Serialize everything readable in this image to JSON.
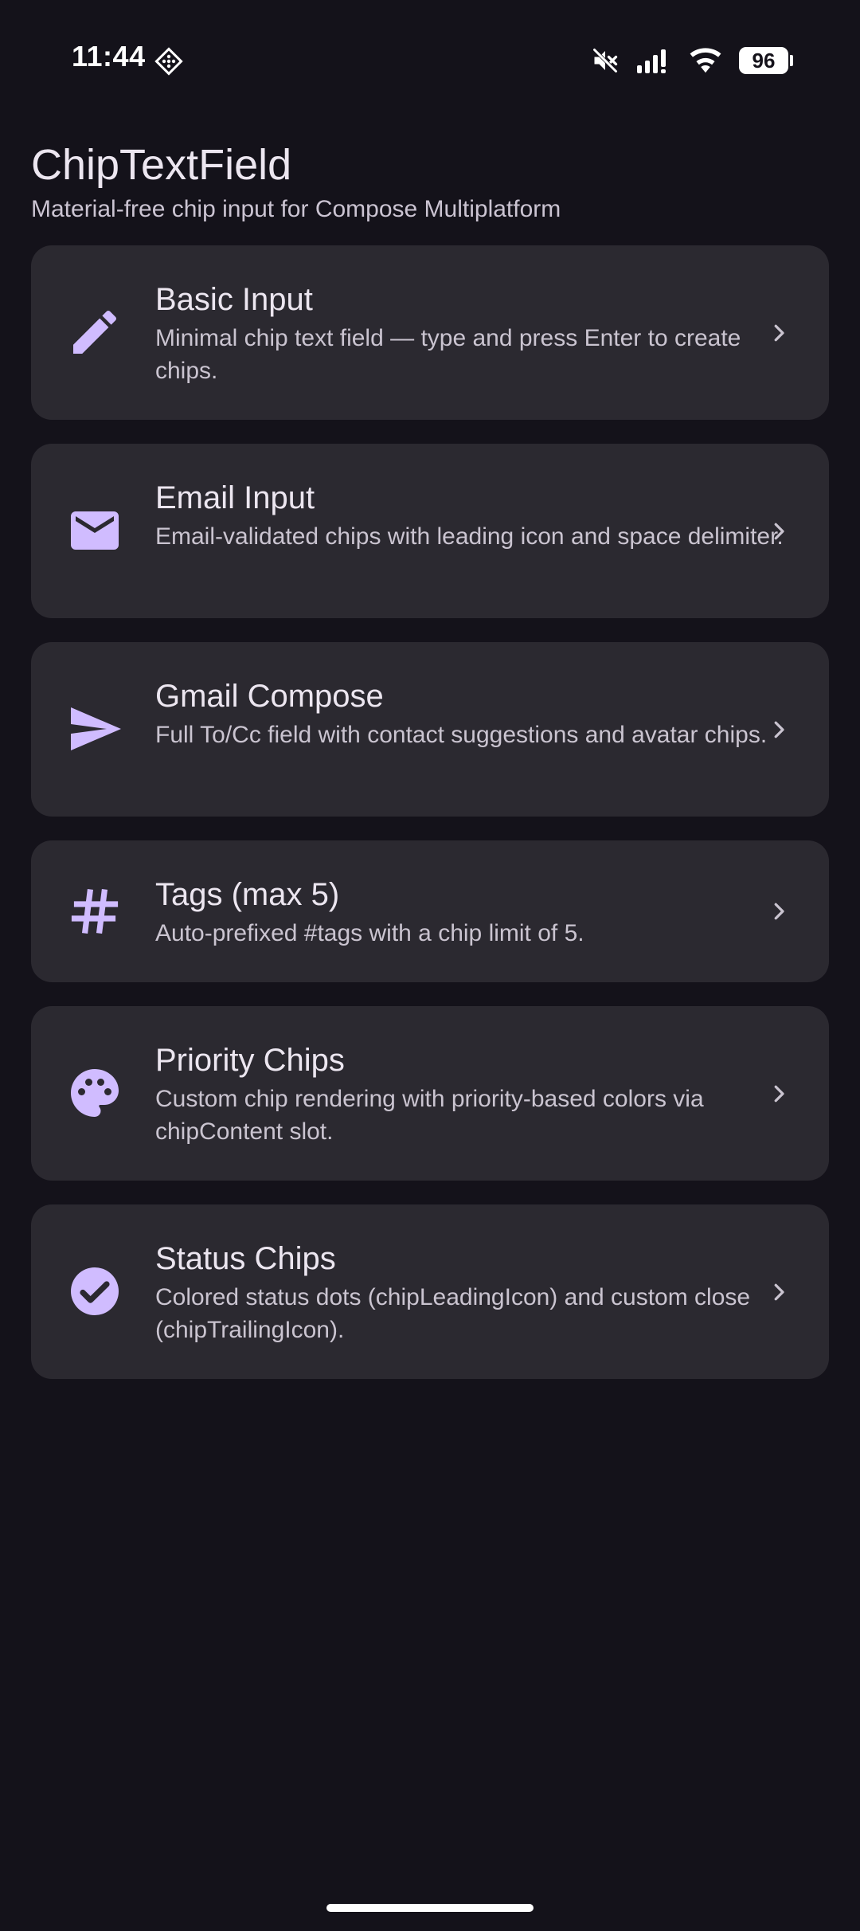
{
  "status_bar": {
    "time": "11:44",
    "battery": "96",
    "icons": [
      "developer-app-icon",
      "mute-icon",
      "signal-icon",
      "wifi-icon",
      "battery-icon"
    ]
  },
  "header": {
    "title": "ChipTextField",
    "subtitle": "Material-free chip input for Compose Multiplatform"
  },
  "accent_color": "#d0bcff",
  "cards": [
    {
      "icon": "pencil-icon",
      "title": "Basic Input",
      "desc": "Minimal chip text field — type and press Enter to create chips."
    },
    {
      "icon": "mail-icon",
      "title": "Email Input",
      "desc": "Email-validated chips with leading icon and space delimiter."
    },
    {
      "icon": "send-icon",
      "title": "Gmail Compose",
      "desc": "Full To/Cc field with contact suggestions and avatar chips."
    },
    {
      "icon": "hashtag-icon",
      "title": "Tags (max 5)",
      "desc": "Auto-prefixed #tags with a chip limit of 5."
    },
    {
      "icon": "palette-icon",
      "title": "Priority Chips",
      "desc": "Custom chip rendering with priority-based colors via chipContent slot."
    },
    {
      "icon": "check-circle-icon",
      "title": "Status Chips",
      "desc": "Colored status dots (chipLeadingIcon) and custom close (chipTrailingIcon)."
    }
  ]
}
